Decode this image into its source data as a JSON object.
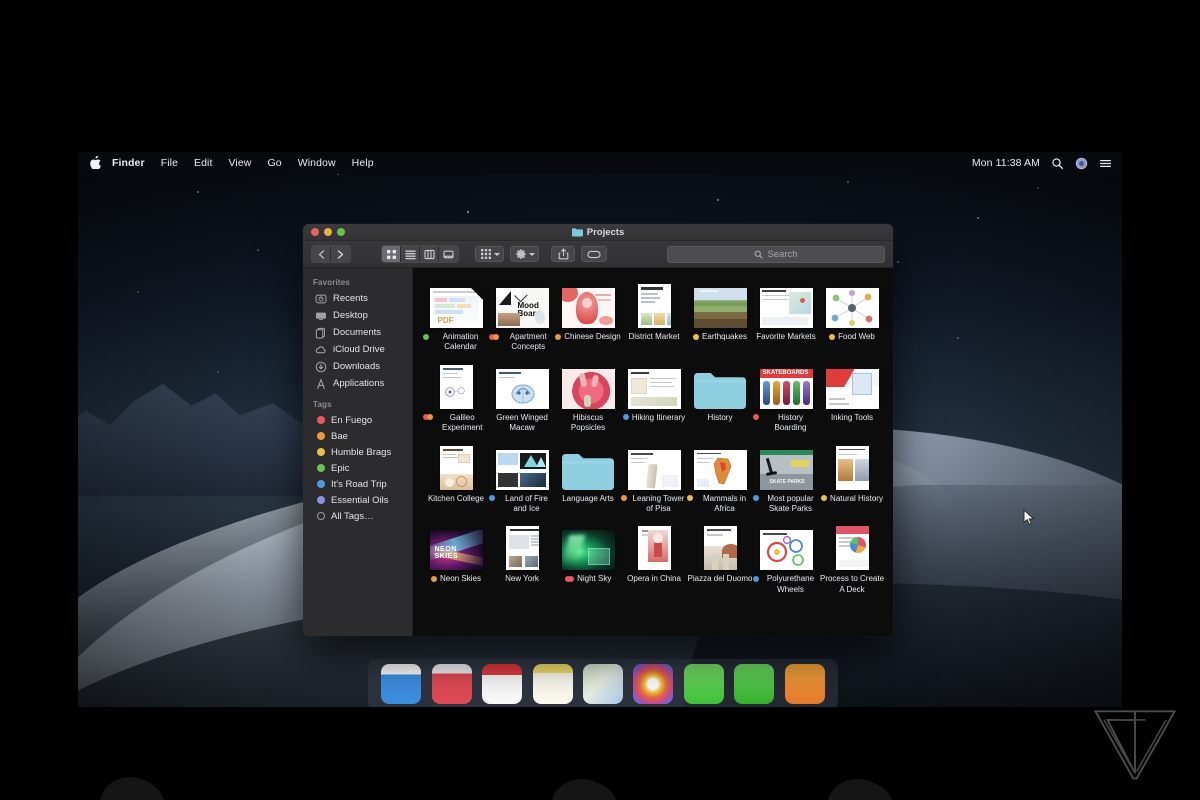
{
  "menubar": {
    "apple_glyph": "",
    "items": [
      {
        "label": "Finder",
        "bold": true
      },
      {
        "label": "File"
      },
      {
        "label": "Edit"
      },
      {
        "label": "View"
      },
      {
        "label": "Go"
      },
      {
        "label": "Window"
      },
      {
        "label": "Help"
      }
    ],
    "clock": "Mon 11:38 AM",
    "right_icons": [
      "search-icon",
      "siri-icon",
      "control-center-icon"
    ]
  },
  "window": {
    "title": "Projects",
    "traffic_lights": [
      "close",
      "minimize",
      "zoom"
    ],
    "toolbar": {
      "nav": [
        "back",
        "forward"
      ],
      "view_modes": [
        "icon-view",
        "list-view",
        "column-view",
        "gallery-view"
      ],
      "selected_view": "icon-view",
      "group_by_label": "group-by",
      "action_label": "action",
      "share_label": "share",
      "tags_label": "tags",
      "search_placeholder": "Search"
    }
  },
  "sidebar": {
    "favorites_header": "Favorites",
    "favorites": [
      {
        "label": "Recents",
        "icon": "clock-icon"
      },
      {
        "label": "Desktop",
        "icon": "desktop-icon"
      },
      {
        "label": "Documents",
        "icon": "documents-icon"
      },
      {
        "label": "iCloud Drive",
        "icon": "cloud-icon"
      },
      {
        "label": "Downloads",
        "icon": "download-icon"
      },
      {
        "label": "Applications",
        "icon": "applications-icon"
      }
    ],
    "tags_header": "Tags",
    "tags": [
      {
        "label": "En Fuego",
        "color": "#e8595e"
      },
      {
        "label": "Bae",
        "color": "#e99a3c"
      },
      {
        "label": "Humble Brags",
        "color": "#e6c348"
      },
      {
        "label": "Epic",
        "color": "#69c24f"
      },
      {
        "label": "It's Road Trip",
        "color": "#4e9ae0"
      },
      {
        "label": "Essential Oils",
        "color": "#8f8ee4"
      },
      {
        "label": "All Tags…",
        "color": "hollow"
      }
    ]
  },
  "files": [
    {
      "name": "Animation Calendar",
      "kind": "document",
      "tags": [
        "#69c24f"
      ],
      "art": "calendar-pdf"
    },
    {
      "name": "Apartment Concepts",
      "kind": "document",
      "tags": [
        "#e8595e",
        "#e99a3c"
      ],
      "art": "mood-board"
    },
    {
      "name": "Chinese Design",
      "kind": "document",
      "tags": [
        "#e99a3c"
      ],
      "art": "chinese-red"
    },
    {
      "name": "District Market",
      "kind": "document",
      "tags": [],
      "art": "market-page"
    },
    {
      "name": "Earthquakes",
      "kind": "document",
      "tags": [
        "#e6c348"
      ],
      "art": "earthquake-land"
    },
    {
      "name": "Favorite Markets",
      "kind": "document",
      "tags": [],
      "art": "markets-map"
    },
    {
      "name": "Food Web",
      "kind": "document",
      "tags": [
        "#e6c348"
      ],
      "art": "food-web"
    },
    {
      "name": "Galileo Experiment",
      "kind": "document",
      "tags": [
        "#e8595e",
        "#e99a3c"
      ],
      "art": "galileo"
    },
    {
      "name": "Green Winged Macaw",
      "kind": "document",
      "tags": [],
      "art": "macaw-diagram"
    },
    {
      "name": "Hibiscus Popsicles",
      "kind": "document",
      "tags": [],
      "art": "hibiscus"
    },
    {
      "name": "Hiking Itinerary",
      "kind": "document",
      "tags": [
        "#4e9ae0"
      ],
      "art": "hiking-list"
    },
    {
      "name": "History",
      "kind": "folder",
      "tags": [],
      "art": "folder"
    },
    {
      "name": "History Boarding",
      "kind": "document",
      "tags": [
        "#e8595e"
      ],
      "art": "skateboards"
    },
    {
      "name": "Inking Tools",
      "kind": "document",
      "tags": [],
      "art": "inking"
    },
    {
      "name": "Kitchen College",
      "kind": "document",
      "tags": [],
      "art": "kitchen-page"
    },
    {
      "name": "Land of Fire and Ice",
      "kind": "document",
      "tags": [
        "#4e9ae0"
      ],
      "art": "fire-ice"
    },
    {
      "name": "Language Arts",
      "kind": "folder",
      "tags": [],
      "art": "folder"
    },
    {
      "name": "Leaning Tower of Pisa",
      "kind": "document",
      "tags": [
        "#e99a3c"
      ],
      "art": "pisa"
    },
    {
      "name": "Mammals in Africa",
      "kind": "document",
      "tags": [
        "#e6c348"
      ],
      "art": "africa-map"
    },
    {
      "name": "Most popular Skate Parks",
      "kind": "document",
      "tags": [
        "#4e9ae0"
      ],
      "art": "skate-parks"
    },
    {
      "name": "Natural History",
      "kind": "document",
      "tags": [
        "#e6c348"
      ],
      "art": "natural-history"
    },
    {
      "name": "Neon Skies",
      "kind": "document",
      "tags": [
        "#e99a3c"
      ],
      "art": "neon-skies"
    },
    {
      "name": "New York",
      "kind": "document",
      "tags": [],
      "art": "nyc-page"
    },
    {
      "name": "Night Sky",
      "kind": "document",
      "tags": [
        "#e8595e",
        "#e8595e"
      ],
      "art": "aurora"
    },
    {
      "name": "Opera in China",
      "kind": "document",
      "tags": [],
      "art": "opera"
    },
    {
      "name": "Piazza del Duomo",
      "kind": "document",
      "tags": [],
      "art": "duomo"
    },
    {
      "name": "Polyurethane Wheels",
      "kind": "document",
      "tags": [
        "#4e9ae0"
      ],
      "art": "wheels"
    },
    {
      "name": "Process to Create A Deck",
      "kind": "document",
      "tags": [],
      "art": "deck-process"
    }
  ],
  "dock": {
    "icons": [
      "calendar-icon",
      "reminders-icon",
      "calendar-jun-icon",
      "notes-icon",
      "maps-icon",
      "photos-icon",
      "messages-icon",
      "facetime-icon",
      "itunes-icon"
    ]
  },
  "watermark": {
    "name": "the-verge-logo"
  },
  "colors": {
    "window_bg": "#1e1e1e",
    "sidebar_bg": "#2c2c2e",
    "content_bg": "#0c0c0d",
    "folder_blue": "#8fcfe0"
  }
}
